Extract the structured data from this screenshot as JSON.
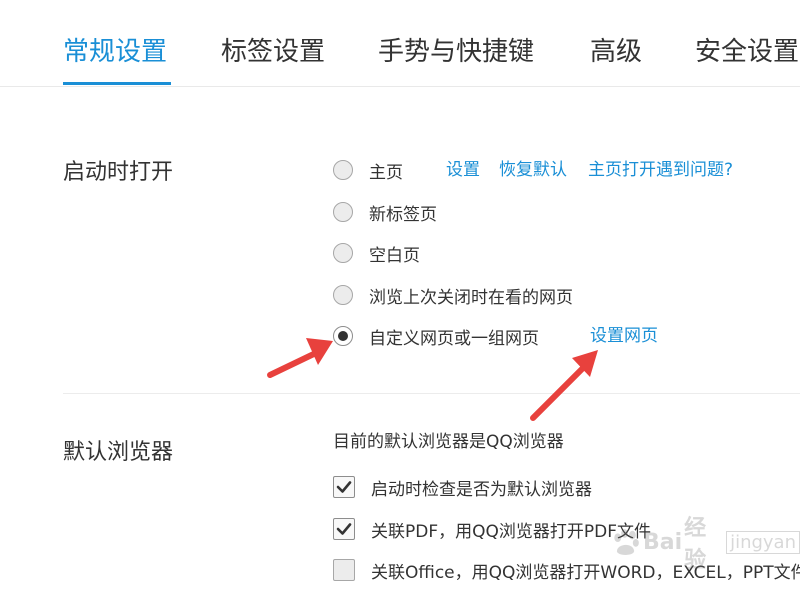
{
  "tabs": [
    {
      "label": "常规设置",
      "active": true
    },
    {
      "label": "标签设置",
      "active": false
    },
    {
      "label": "手势与快捷键",
      "active": false
    },
    {
      "label": "高级",
      "active": false
    },
    {
      "label": "安全设置",
      "active": false
    }
  ],
  "startup": {
    "title": "启动时打开",
    "options": [
      {
        "label": "主页",
        "checked": false
      },
      {
        "label": "新标签页",
        "checked": false
      },
      {
        "label": "空白页",
        "checked": false
      },
      {
        "label": "浏览上次关闭时在看的网页",
        "checked": false
      },
      {
        "label": "自定义网页或一组网页",
        "checked": true
      }
    ],
    "homepage_links": {
      "settings": "设置",
      "restore": "恢复默认",
      "problem": "主页打开遇到问题?"
    },
    "custom_link": "设置网页"
  },
  "default_browser": {
    "title": "默认浏览器",
    "status": "目前的默认浏览器是QQ浏览器",
    "checks": [
      {
        "label": "启动时检查是否为默认浏览器",
        "checked": true
      },
      {
        "label": "关联PDF，用QQ浏览器打开PDF文件",
        "checked": true
      },
      {
        "label": "关联Office，用QQ浏览器打开WORD，EXCEL，PPT文件",
        "checked": false
      }
    ]
  },
  "colors": {
    "accent": "#1a8fd6",
    "annotation_arrow": "#e8413d"
  },
  "watermark": {
    "text": "Bai",
    "brand": "经验",
    "box": "jingyan"
  }
}
